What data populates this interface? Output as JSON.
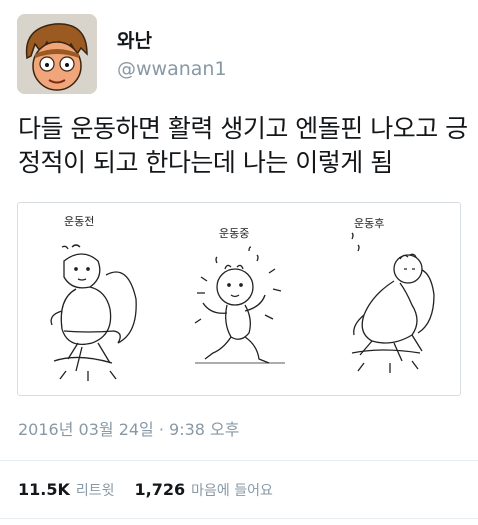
{
  "author": {
    "display_name": "와난",
    "handle": "@wwanan1"
  },
  "tweet": {
    "text": "다들 운동하면 활력 생기고 엔돌핀 나오고 긍정적이 되고 한다는데 나는 이렇게 됨",
    "timestamp": "2016년 03월 24일 · 9:38 오후"
  },
  "media": {
    "panels": [
      {
        "label": "운동전"
      },
      {
        "label": "운동중"
      },
      {
        "label": "운동후"
      }
    ]
  },
  "stats": {
    "retweets_count": "11.5K",
    "retweets_label": "리트윗",
    "likes_count": "1,726",
    "likes_label": "마음에 들어요"
  },
  "icons": {
    "avatar": "cartoon-face-avatar"
  }
}
